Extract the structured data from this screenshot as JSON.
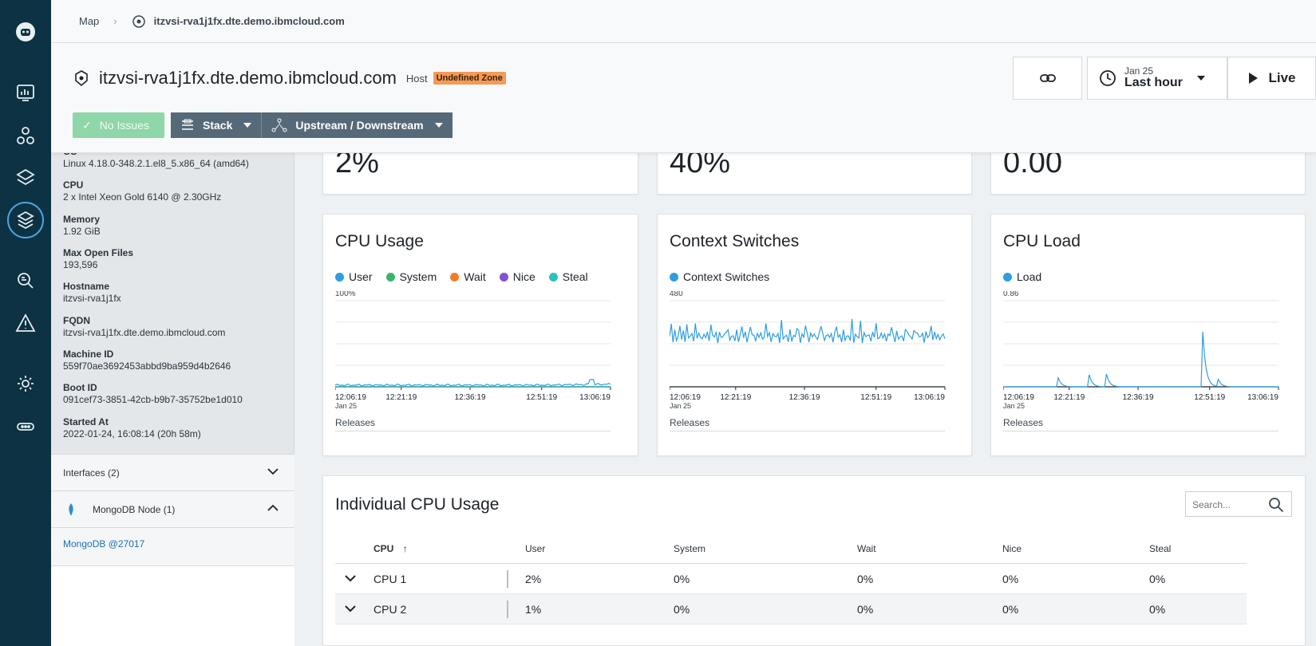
{
  "breadcrumb": {
    "root": "Map",
    "host": "itzvsi-rva1j1fx.dte.demo.ibmcloud.com"
  },
  "header": {
    "title": "itzvsi-rva1j1fx.dte.demo.ibmcloud.com",
    "entity_type": "Host",
    "zone_badge": "Undefined Zone",
    "issues_label": "No Issues",
    "stack_label": "Stack",
    "upstream_label": "Upstream / Downstream",
    "time_date": "Jan 25",
    "time_period": "Last hour",
    "live_label": "Live"
  },
  "sidebar": {
    "properties": [
      {
        "key": "OS",
        "value": "Linux 4.18.0-348.2.1.el8_5.x86_64 (amd64)"
      },
      {
        "key": "CPU",
        "value": "2 x Intel Xeon Gold 6140 @ 2.30GHz"
      },
      {
        "key": "Memory",
        "value": "1.92 GiB"
      },
      {
        "key": "Max Open Files",
        "value": "193,596"
      },
      {
        "key": "Hostname",
        "value": "itzvsi-rva1j1fx"
      },
      {
        "key": "FQDN",
        "value": "itzvsi-rva1j1fx.dte.demo.ibmcloud.com"
      },
      {
        "key": "Machine ID",
        "value": "559f70ae3692453abbd9ba959d4b2646"
      },
      {
        "key": "Boot ID",
        "value": "091cef73-3851-42cb-b9b7-35752be1d010"
      },
      {
        "key": "Started At",
        "value": "2022-01-24, 16:08:14 (20h 58m)"
      }
    ],
    "interfaces_label": "Interfaces (2)",
    "mongodb_label": "MongoDB Node (1)",
    "mongodb_link": "MongoDB @27017"
  },
  "stats": {
    "cpu": "2%",
    "memory": "40%",
    "load": "0.00"
  },
  "charts": {
    "cpu_usage": {
      "title": "CPU Usage",
      "ymax_label": "100%",
      "legend": [
        "User",
        "System",
        "Wait",
        "Nice",
        "Steal"
      ]
    },
    "context_switches": {
      "title": "Context Switches",
      "ymax_label": "480",
      "legend": [
        "Context Switches"
      ]
    },
    "cpu_load": {
      "title": "CPU Load",
      "ymax_label": "0.86",
      "legend": [
        "Load"
      ]
    },
    "x_ticks": [
      "12:06:19",
      "12:21:19",
      "12:36:19",
      "12:51:19",
      "13:06:19"
    ],
    "x_date": "Jan 25",
    "releases_label": "Releases"
  },
  "chart_data": [
    {
      "type": "line",
      "title": "CPU Usage",
      "x": [
        "12:06:19",
        "12:21:19",
        "12:36:19",
        "12:51:19",
        "13:06:19"
      ],
      "ylim": [
        0,
        100
      ],
      "series": [
        {
          "name": "User",
          "values": [
            2,
            2,
            2,
            2,
            3
          ]
        },
        {
          "name": "System",
          "values": [
            0,
            0,
            0,
            0,
            0
          ]
        },
        {
          "name": "Wait",
          "values": [
            0,
            0,
            0,
            0,
            0
          ]
        },
        {
          "name": "Nice",
          "values": [
            0,
            0,
            0,
            0,
            0
          ]
        },
        {
          "name": "Steal",
          "values": [
            0,
            0,
            0,
            0,
            0
          ]
        }
      ]
    },
    {
      "type": "line",
      "title": "Context Switches",
      "x": [
        "12:06:19",
        "12:21:19",
        "12:36:19",
        "12:51:19",
        "13:06:19"
      ],
      "ylim": [
        0,
        480
      ],
      "series": [
        {
          "name": "Context Switches",
          "values": [
            300,
            300,
            300,
            300,
            300
          ]
        }
      ]
    },
    {
      "type": "line",
      "title": "CPU Load",
      "x": [
        "12:06:19",
        "12:21:19",
        "12:36:19",
        "12:51:19",
        "13:06:19"
      ],
      "ylim": [
        0,
        0.86
      ],
      "series": [
        {
          "name": "Load",
          "values": [
            0,
            0.05,
            0,
            0.86,
            0
          ]
        }
      ]
    }
  ],
  "table": {
    "title": "Individual CPU Usage",
    "search_placeholder": "Search...",
    "columns": [
      "CPU",
      "User",
      "System",
      "Wait",
      "Nice",
      "Steal"
    ],
    "rows": [
      {
        "cpu": "CPU 1",
        "user": "2%",
        "system": "0%",
        "wait": "0%",
        "nice": "0%",
        "steal": "0%"
      },
      {
        "cpu": "CPU 2",
        "user": "1%",
        "system": "0%",
        "wait": "0%",
        "nice": "0%",
        "steal": "0%"
      }
    ]
  },
  "colors": {
    "user": "#2d9ee0",
    "system": "#3bb56b",
    "wait": "#f07d2a",
    "nice": "#8150d6",
    "steal": "#2bc1c0",
    "nav_bg": "#0c3243",
    "zone_badge": "#f29a56"
  }
}
